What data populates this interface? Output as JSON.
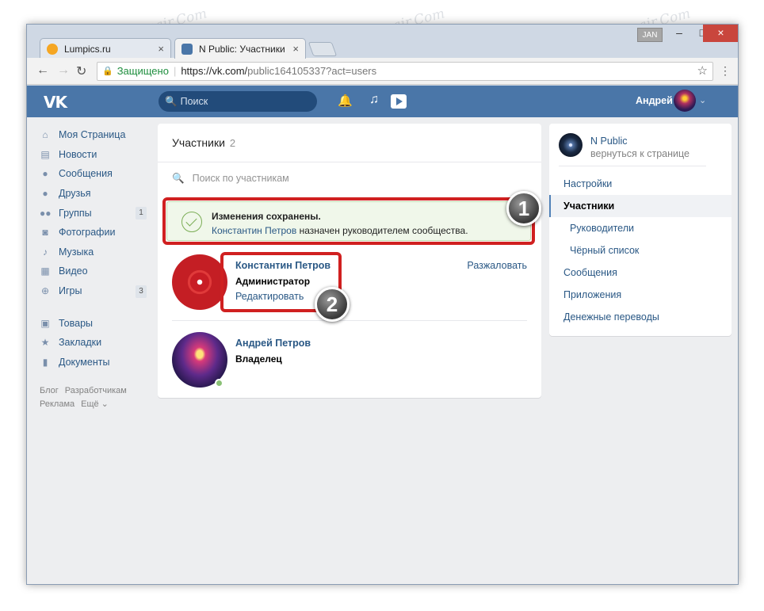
{
  "browser": {
    "tabs": [
      {
        "title": "Lumpics.ru",
        "close": "×"
      },
      {
        "title": "N Public: Участники",
        "close": "×"
      }
    ],
    "user_badge": "JAN",
    "window_buttons": {
      "minimize": "–",
      "maximize": "□",
      "close": "×"
    },
    "nav": {
      "back": "←",
      "forward": "→",
      "reload": "↻"
    },
    "address": {
      "secure_label": "Защищено",
      "separator": "|",
      "url_host": "https://vk.com/",
      "url_rest": "public164105337?act=users"
    }
  },
  "vk_header": {
    "logo": "VK",
    "search_placeholder": "Поиск",
    "user_name": "Андрей"
  },
  "left_nav": {
    "items": [
      {
        "label": "Моя Страница",
        "icon": "home-icon"
      },
      {
        "label": "Новости",
        "icon": "news-icon"
      },
      {
        "label": "Сообщения",
        "icon": "messages-icon"
      },
      {
        "label": "Друзья",
        "icon": "friends-icon"
      },
      {
        "label": "Группы",
        "icon": "groups-icon",
        "count": "1"
      },
      {
        "label": "Фотографии",
        "icon": "photos-icon"
      },
      {
        "label": "Музыка",
        "icon": "music-icon"
      },
      {
        "label": "Видео",
        "icon": "video-icon"
      },
      {
        "label": "Игры",
        "icon": "games-icon",
        "count": "3"
      }
    ],
    "items2": [
      {
        "label": "Товары",
        "icon": "goods-icon"
      },
      {
        "label": "Закладки",
        "icon": "bookmarks-icon"
      },
      {
        "label": "Документы",
        "icon": "documents-icon"
      }
    ],
    "footer": [
      "Блог",
      "Разработчикам",
      "Реклама",
      "Ещё ⌄"
    ]
  },
  "main": {
    "title": "Участники",
    "count": "2",
    "search_placeholder": "Поиск по участникам",
    "notice": {
      "title": "Изменения сохранены.",
      "person": "Константин Петров",
      "text_rest": " назначен руководителем сообщества."
    },
    "members": [
      {
        "name": "Константин Петров",
        "role": "Администратор",
        "edit": "Редактировать",
        "demote": "Разжаловать"
      },
      {
        "name": "Андрей Петров",
        "role": "Владелец"
      }
    ]
  },
  "callouts": [
    "1",
    "2"
  ],
  "right_menu": {
    "group_name": "N Public",
    "back_link": "вернуться к странице",
    "items": [
      {
        "label": "Настройки"
      },
      {
        "label": "Участники",
        "active": true
      },
      {
        "label": "Руководители",
        "sub": true
      },
      {
        "label": "Чёрный список",
        "sub": true
      },
      {
        "label": "Сообщения"
      },
      {
        "label": "Приложения"
      },
      {
        "label": "Денежные переводы"
      }
    ]
  },
  "watermark": "Soringpcrepair.Com",
  "colors": {
    "vk_blue": "#4a76a8",
    "link": "#2a5885",
    "notice_bg": "#f0f7ea",
    "highlight_red": "#d02020"
  }
}
